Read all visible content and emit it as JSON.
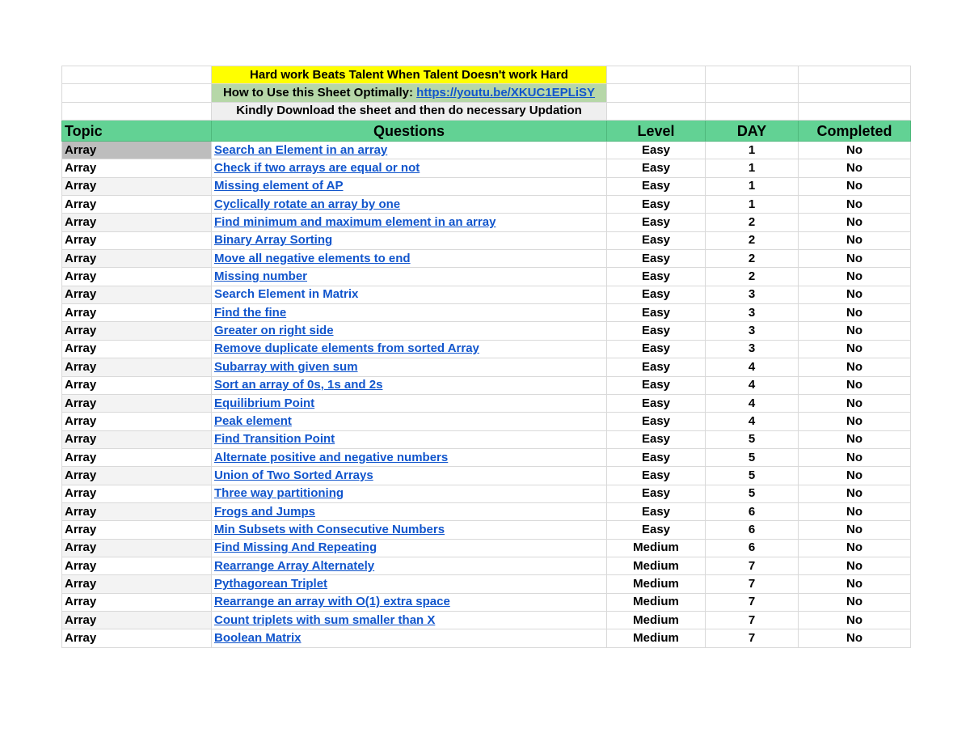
{
  "banners": {
    "motto": "Hard work Beats Talent When Talent Doesn't work Hard",
    "howto_label": "How to Use this Sheet Optimally: ",
    "howto_link": "https://youtu.be/XKUC1EPLiSY",
    "download_note": "Kindly Download the sheet and then do necessary Updation"
  },
  "colors": {
    "header_green": "#62d294",
    "motto_yellow": "#ffff00",
    "howto_green": "#b6d7a8",
    "link_blue": "#1155cc"
  },
  "headers": [
    "Topic",
    "Questions",
    "Level",
    "DAY",
    "Completed"
  ],
  "rows": [
    {
      "topic": "Array",
      "question": "Search an Element in an array",
      "level": "Easy",
      "day": "1",
      "completed": "No"
    },
    {
      "topic": "Array",
      "question": "Check if two arrays are equal or not",
      "level": "Easy",
      "day": "1",
      "completed": "No"
    },
    {
      "topic": "Array",
      "question": "Missing element of AP",
      "level": "Easy",
      "day": "1",
      "completed": "No"
    },
    {
      "topic": "Array",
      "question": "Cyclically rotate an array by one",
      "level": "Easy",
      "day": "1",
      "completed": "No"
    },
    {
      "topic": "Array",
      "question": "Find minimum and maximum element in an array",
      "level": "Easy",
      "day": "2",
      "completed": "No"
    },
    {
      "topic": "Array",
      "question": "Binary Array Sorting",
      "level": "Easy",
      "day": "2",
      "completed": "No"
    },
    {
      "topic": "Array",
      "question": "Move all negative elements to end",
      "level": "Easy",
      "day": "2",
      "completed": "No"
    },
    {
      "topic": "Array",
      "question": "Missing number",
      "level": "Easy",
      "day": "2",
      "completed": "No"
    },
    {
      "topic": "Array",
      "question": "Search Element in Matrix",
      "level": "Easy",
      "day": "3",
      "completed": "No",
      "no_underline": true
    },
    {
      "topic": "Array",
      "question": "Find the fine",
      "level": "Easy",
      "day": "3",
      "completed": "No"
    },
    {
      "topic": "Array",
      "question": "Greater on right side",
      "level": "Easy",
      "day": "3",
      "completed": "No"
    },
    {
      "topic": "Array",
      "question": "Remove duplicate elements from sorted Array",
      "level": "Easy",
      "day": "3",
      "completed": "No"
    },
    {
      "topic": "Array",
      "question": "Subarray with given sum",
      "level": "Easy",
      "day": "4",
      "completed": "No"
    },
    {
      "topic": "Array",
      "question": "Sort an array of 0s, 1s and 2s",
      "level": "Easy",
      "day": "4",
      "completed": "No"
    },
    {
      "topic": "Array",
      "question": "Equilibrium Point",
      "level": "Easy",
      "day": "4",
      "completed": "No"
    },
    {
      "topic": "Array",
      "question": "Peak element",
      "level": "Easy",
      "day": "4",
      "completed": "No"
    },
    {
      "topic": "Array",
      "question": "Find Transition Point",
      "level": "Easy",
      "day": "5",
      "completed": "No"
    },
    {
      "topic": "Array",
      "question": "Alternate positive and negative numbers",
      "level": "Easy",
      "day": "5",
      "completed": "No"
    },
    {
      "topic": "Array",
      "question": "Union of Two Sorted Arrays",
      "level": "Easy",
      "day": "5",
      "completed": "No"
    },
    {
      "topic": "Array",
      "question": "Three way partitioning",
      "level": "Easy",
      "day": "5",
      "completed": "No"
    },
    {
      "topic": "Array",
      "question": "Frogs and Jumps",
      "level": "Easy",
      "day": "6",
      "completed": "No"
    },
    {
      "topic": "Array",
      "question": "Min Subsets with Consecutive Numbers",
      "level": "Easy",
      "day": "6",
      "completed": "No"
    },
    {
      "topic": "Array",
      "question": "Find Missing And Repeating",
      "level": "Medium",
      "day": "6",
      "completed": "No"
    },
    {
      "topic": "Array",
      "question": "Rearrange Array Alternately",
      "level": "Medium",
      "day": "7",
      "completed": "No"
    },
    {
      "topic": "Array",
      "question": "Pythagorean Triplet",
      "level": "Medium",
      "day": "7",
      "completed": "No"
    },
    {
      "topic": "Array",
      "question": "Rearrange an array with O(1) extra space",
      "level": "Medium",
      "day": "7",
      "completed": "No"
    },
    {
      "topic": "Array",
      "question": "Count triplets with sum smaller than X",
      "level": "Medium",
      "day": "7",
      "completed": "No"
    },
    {
      "topic": "Array",
      "question": "Boolean Matrix",
      "level": "Medium",
      "day": "7",
      "completed": "No"
    }
  ]
}
